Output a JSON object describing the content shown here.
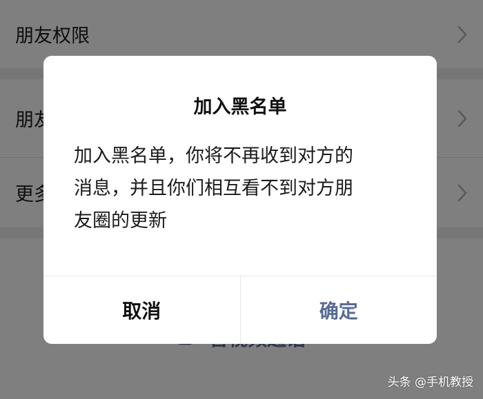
{
  "settings": {
    "items": [
      {
        "label": "朋友权限"
      },
      {
        "label": "朋友圈和视频动态"
      },
      {
        "label": "更多信息"
      }
    ],
    "video_call_label": "音视频通话"
  },
  "dialog": {
    "title": "加入黑名单",
    "message_lines": [
      "加入黑名单，你将不再收到对方的",
      "消息，并且你们相互看不到对方朋",
      "友圈的更新"
    ],
    "cancel_label": "取消",
    "confirm_label": "确定"
  },
  "watermark": {
    "text": "头条 @手机教授"
  },
  "colors": {
    "accent": "#576b95",
    "overlay": "rgba(0,0,0,0.5)",
    "page_background": "#ededed"
  }
}
